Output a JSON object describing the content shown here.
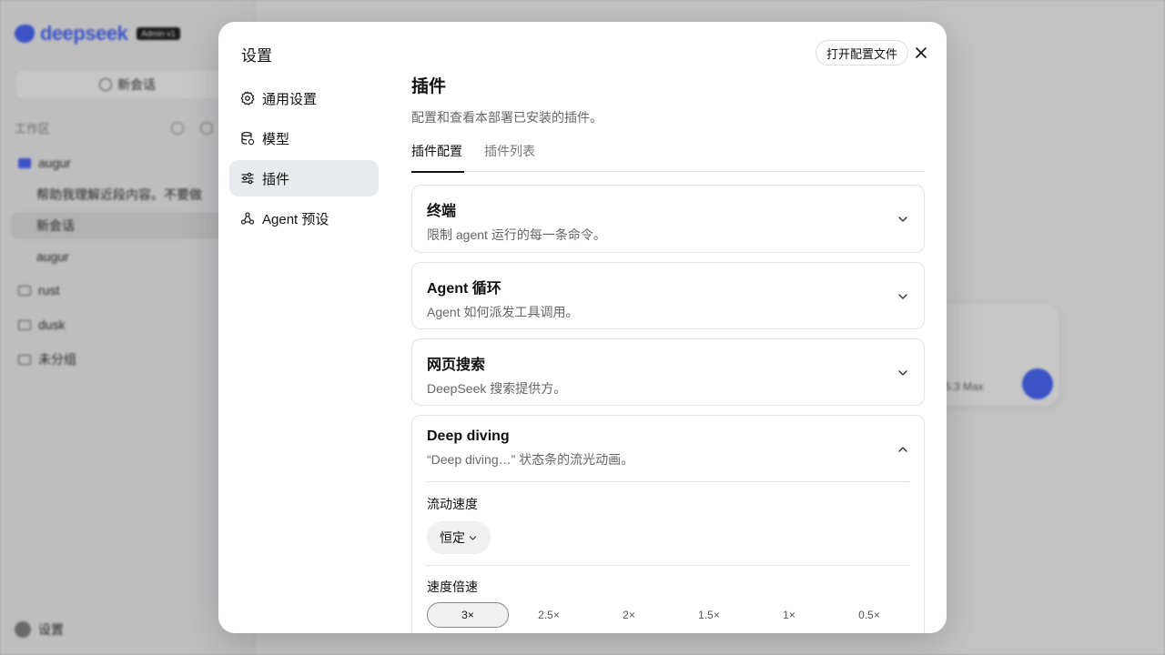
{
  "background": {
    "logo_text": "deepseek",
    "logo_badge": "Admin v1",
    "new_chat": "新会话",
    "workspace_label": "工作区",
    "items": [
      {
        "label": "augur",
        "type": "folder-open"
      },
      {
        "label": "帮助我理解近段内容。不要做",
        "type": "sub"
      },
      {
        "label": "新会话",
        "type": "sub-active"
      },
      {
        "label": "augur",
        "type": "sub"
      },
      {
        "label": "rust",
        "type": "folder"
      },
      {
        "label": "dusk",
        "type": "folder"
      },
      {
        "label": "未分组",
        "type": "folder"
      }
    ],
    "settings_label": "设置",
    "model_label": "5.3 Max"
  },
  "modal": {
    "title": "设置",
    "open_config_label": "打开配置文件",
    "nav": [
      {
        "label": "通用设置",
        "icon": "gear-icon",
        "active": false
      },
      {
        "label": "模型",
        "icon": "database-icon",
        "active": false
      },
      {
        "label": "插件",
        "icon": "sliders-icon",
        "active": true
      },
      {
        "label": "Agent 预设",
        "icon": "agent-icon",
        "active": false
      }
    ],
    "page_title": "插件",
    "page_desc": "配置和查看本部署已安装的插件。",
    "tabs": [
      {
        "label": "插件配置",
        "active": true
      },
      {
        "label": "插件列表",
        "active": false
      }
    ],
    "panels": [
      {
        "title": "终端",
        "desc": "限制 agent 运行的每一条命令。",
        "expanded": false
      },
      {
        "title": "Agent 循环",
        "desc": "Agent 如何派发工具调用。",
        "expanded": false
      },
      {
        "title": "网页搜索",
        "desc": "DeepSeek 搜索提供方。",
        "expanded": false
      },
      {
        "title": "Deep diving",
        "desc": "“Deep diving…” 状态条的流光动画。",
        "expanded": true
      }
    ],
    "flow_speed": {
      "label": "流动速度",
      "value": "恒定"
    },
    "speed_multiplier": {
      "label": "速度倍速",
      "options": [
        "3×",
        "2.5×",
        "2×",
        "1.5×",
        "1×",
        "0.5×"
      ],
      "selected": "3×"
    }
  }
}
